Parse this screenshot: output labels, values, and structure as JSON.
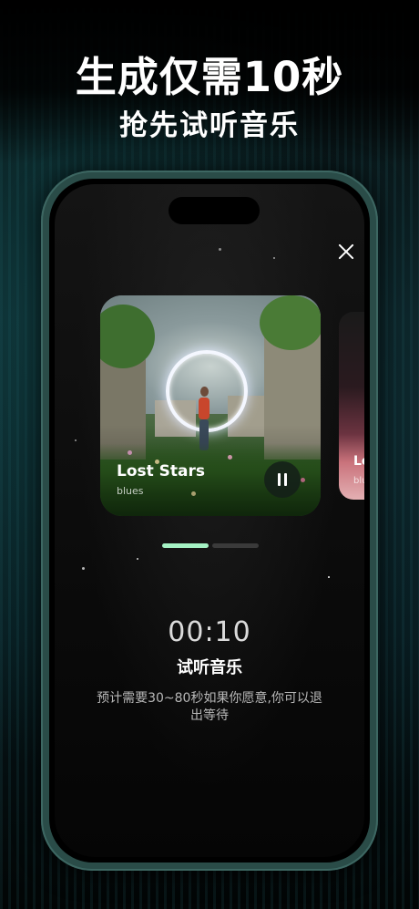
{
  "promo": {
    "headline": "生成仅需10秒",
    "subheadline": "抢先试听音乐"
  },
  "player": {
    "current_card": {
      "title": "Lost Stars",
      "genre": "blues"
    },
    "next_card": {
      "title": "Lo",
      "genre": "blu"
    },
    "carousel": {
      "count": 2,
      "active_index": 0
    },
    "timer": "00:10",
    "status": "试听音乐",
    "note": "预计需要30~80秒如果你愿意,你可以退出等待"
  },
  "icons": {
    "close": "close-icon",
    "pause": "pause-icon"
  },
  "colors": {
    "accent": "#a5f2c4",
    "phone_frame": "#2a4c48"
  }
}
